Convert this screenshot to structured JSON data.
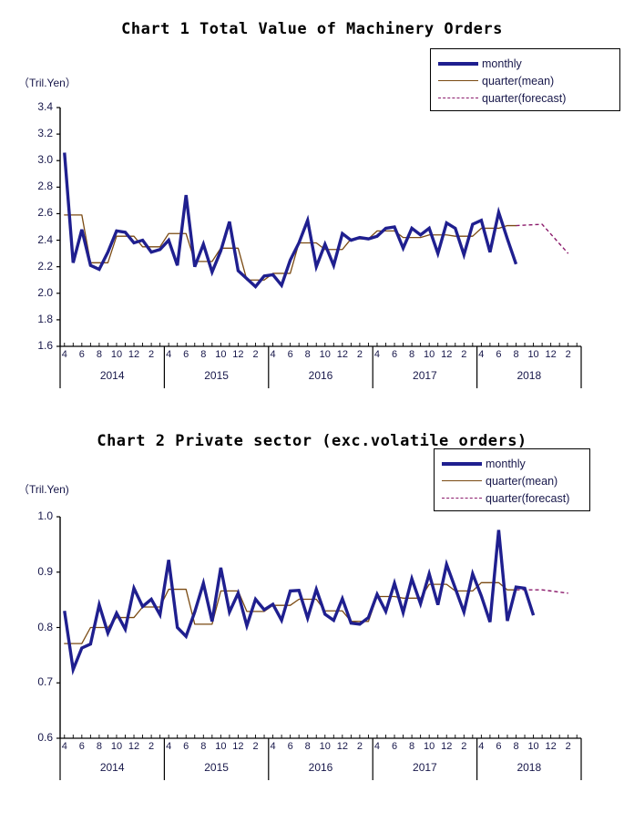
{
  "charts": [
    {
      "id": "chart1",
      "title": "Chart 1 Total Value of Machinery Orders",
      "unit": "（Tril.Yen）",
      "legend": [
        {
          "key": "monthly",
          "label": "monthly"
        },
        {
          "key": "mean",
          "label": "quarter(mean)"
        },
        {
          "key": "forecast",
          "label": "quarter(forecast)"
        }
      ]
    },
    {
      "id": "chart2",
      "title": "Chart 2 Private sector (exc.volatile orders)",
      "unit": "（Tril.Yen)",
      "legend": [
        {
          "key": "monthly",
          "label": "monthly"
        },
        {
          "key": "mean",
          "label": "quarter(mean)"
        },
        {
          "key": "forecast",
          "label": "quarter(forecast)"
        }
      ]
    }
  ],
  "colors": {
    "monthly": "#1f1f8f",
    "quarter_mean": "#7a4a12",
    "quarter_forecast": "#8b1a6b",
    "axis": "#000000",
    "text": "#17174a"
  },
  "chart_data": [
    {
      "type": "line",
      "title": "Chart 1 Total Value of Machinery Orders",
      "ylabel": "（Tril.Yen）",
      "xlabel": "",
      "ylim": [
        1.6,
        3.4
      ],
      "yticks": [
        "1.6",
        "1.8",
        "2.0",
        "2.2",
        "2.4",
        "2.6",
        "2.8",
        "3.0",
        "3.2",
        "3.4"
      ],
      "grid": false,
      "legend_position": "top-right",
      "fiscal_years": [
        "2014",
        "2015",
        "2016",
        "2017",
        "2018"
      ],
      "xtick_labels": [
        "4",
        "6",
        "8",
        "10",
        "12",
        "2"
      ],
      "months": [
        "2014-04",
        "2014-05",
        "2014-06",
        "2014-07",
        "2014-08",
        "2014-09",
        "2014-10",
        "2014-11",
        "2014-12",
        "2015-01",
        "2015-02",
        "2015-03",
        "2015-04",
        "2015-05",
        "2015-06",
        "2015-07",
        "2015-08",
        "2015-09",
        "2015-10",
        "2015-11",
        "2015-12",
        "2016-01",
        "2016-02",
        "2016-03",
        "2016-04",
        "2016-05",
        "2016-06",
        "2016-07",
        "2016-08",
        "2016-09",
        "2016-10",
        "2016-11",
        "2016-12",
        "2017-01",
        "2017-02",
        "2017-03",
        "2017-04",
        "2017-05",
        "2017-06",
        "2017-07",
        "2017-08",
        "2017-09",
        "2017-10",
        "2017-11",
        "2017-12",
        "2018-01",
        "2018-02",
        "2018-03",
        "2018-04",
        "2018-05",
        "2018-06",
        "2018-07",
        "2018-08",
        "2018-09",
        "2018-10",
        "2018-11",
        "2018-12",
        "2019-01",
        "2019-02",
        "2019-03"
      ],
      "series": [
        {
          "name": "monthly",
          "color": "#1f1f8f",
          "values": [
            3.06,
            2.23,
            2.48,
            2.21,
            2.18,
            2.31,
            2.47,
            2.46,
            2.38,
            2.4,
            2.31,
            2.33,
            2.4,
            2.21,
            2.74,
            2.2,
            2.37,
            2.16,
            2.32,
            2.54,
            2.17,
            2.11,
            2.05,
            2.13,
            2.14,
            2.06,
            2.25,
            2.38,
            2.55,
            2.2,
            2.37,
            2.21,
            2.45,
            2.4,
            2.42,
            2.41,
            2.43,
            2.49,
            2.5,
            2.34,
            2.49,
            2.44,
            2.49,
            2.3,
            2.53,
            2.49,
            2.29,
            2.52,
            2.55,
            2.31,
            2.61,
            2.41,
            2.22
          ]
        },
        {
          "name": "quarter(mean)",
          "color": "#7a4a12",
          "values": [
            2.59,
            2.59,
            2.59,
            2.23,
            2.23,
            2.23,
            2.43,
            2.43,
            2.43,
            2.35,
            2.35,
            2.35,
            2.45,
            2.45,
            2.45,
            2.24,
            2.24,
            2.24,
            2.34,
            2.34,
            2.34,
            2.1,
            2.1,
            2.1,
            2.15,
            2.15,
            2.15,
            2.38,
            2.38,
            2.38,
            2.33,
            2.33,
            2.33,
            2.41,
            2.41,
            2.41,
            2.47,
            2.47,
            2.47,
            2.42,
            2.42,
            2.42,
            2.44,
            2.44,
            2.44,
            2.43,
            2.43,
            2.43,
            2.49,
            2.49,
            2.49,
            2.51,
            2.51
          ]
        },
        {
          "name": "quarter(forecast)",
          "color": "#8b1a6b",
          "values": [
            2.52,
            2.3
          ]
        }
      ]
    },
    {
      "type": "line",
      "title": "Chart 2 Private sector (exc.volatile orders)",
      "ylabel": "（Tril.Yen)",
      "xlabel": "",
      "ylim": [
        0.6,
        1.0
      ],
      "yticks": [
        "0.6",
        "0.7",
        "0.8",
        "0.9",
        "1.0"
      ],
      "grid": false,
      "legend_position": "top-right",
      "fiscal_years": [
        "2014",
        "2015",
        "2016",
        "2017",
        "2018"
      ],
      "xtick_labels": [
        "4",
        "6",
        "8",
        "10",
        "12",
        "2"
      ],
      "months": [
        "2014-04",
        "2014-05",
        "2014-06",
        "2014-07",
        "2014-08",
        "2014-09",
        "2014-10",
        "2014-11",
        "2014-12",
        "2015-01",
        "2015-02",
        "2015-03",
        "2015-04",
        "2015-05",
        "2015-06",
        "2015-07",
        "2015-08",
        "2015-09",
        "2015-10",
        "2015-11",
        "2015-12",
        "2016-01",
        "2016-02",
        "2016-03",
        "2016-04",
        "2016-05",
        "2016-06",
        "2016-07",
        "2016-08",
        "2016-09",
        "2016-10",
        "2016-11",
        "2016-12",
        "2017-01",
        "2017-02",
        "2017-03",
        "2017-04",
        "2017-05",
        "2017-06",
        "2017-07",
        "2017-08",
        "2017-09",
        "2017-10",
        "2017-11",
        "2017-12",
        "2018-01",
        "2018-02",
        "2018-03",
        "2018-04",
        "2018-05",
        "2018-06",
        "2018-07",
        "2018-08",
        "2018-09",
        "2018-10",
        "2018-11",
        "2018-12",
        "2019-01",
        "2019-02",
        "2019-03"
      ],
      "series": [
        {
          "name": "monthly",
          "color": "#1f1f8f",
          "values": [
            0.83,
            0.724,
            0.763,
            0.77,
            0.841,
            0.79,
            0.826,
            0.797,
            0.871,
            0.838,
            0.851,
            0.823,
            0.922,
            0.8,
            0.784,
            0.828,
            0.88,
            0.811,
            0.908,
            0.828,
            0.862,
            0.803,
            0.851,
            0.832,
            0.842,
            0.813,
            0.866,
            0.867,
            0.817,
            0.869,
            0.824,
            0.813,
            0.852,
            0.808,
            0.806,
            0.818,
            0.86,
            0.829,
            0.88,
            0.827,
            0.888,
            0.843,
            0.897,
            0.841,
            0.914,
            0.871,
            0.828,
            0.897,
            0.857,
            0.81,
            0.976,
            0.812,
            0.873,
            0.871,
            0.822
          ]
        },
        {
          "name": "quarter(mean)",
          "color": "#7a4a12",
          "values": [
            0.771,
            0.771,
            0.771,
            0.8,
            0.8,
            0.8,
            0.818,
            0.818,
            0.818,
            0.837,
            0.837,
            0.837,
            0.869,
            0.869,
            0.869,
            0.806,
            0.806,
            0.806,
            0.866,
            0.866,
            0.866,
            0.829,
            0.829,
            0.829,
            0.84,
            0.84,
            0.84,
            0.851,
            0.851,
            0.851,
            0.83,
            0.83,
            0.83,
            0.811,
            0.811,
            0.811,
            0.856,
            0.856,
            0.856,
            0.853,
            0.853,
            0.853,
            0.878,
            0.878,
            0.878,
            0.866,
            0.866,
            0.866,
            0.881,
            0.881,
            0.881,
            0.868,
            0.868
          ]
        },
        {
          "name": "quarter(forecast)",
          "color": "#8b1a6b",
          "values": [
            0.868,
            0.862
          ]
        }
      ]
    }
  ]
}
